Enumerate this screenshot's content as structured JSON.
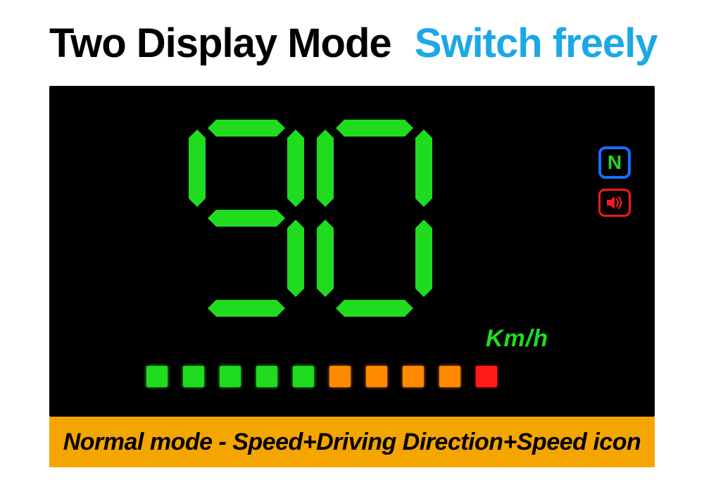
{
  "headline": {
    "title_main": "Two Display Mode",
    "title_accent": "Switch freely"
  },
  "hud": {
    "speed_value": "90",
    "speed_unit": "Km/h",
    "gear_indicator": "N",
    "sound_icon": "sound-icon",
    "speed_bar_colors": [
      "green",
      "green",
      "green",
      "green",
      "green",
      "orange",
      "orange",
      "orange",
      "orange",
      "red"
    ]
  },
  "caption": "Normal mode - Speed+Driving Direction+Speed icon",
  "colors": {
    "accent_blue": "#1ba8e6",
    "led_green": "#1fdc1f",
    "led_orange": "#ff8a00",
    "led_red": "#ff1a1a",
    "caption_bg": "#f5a500",
    "indicator_blue": "#1a6cff"
  }
}
